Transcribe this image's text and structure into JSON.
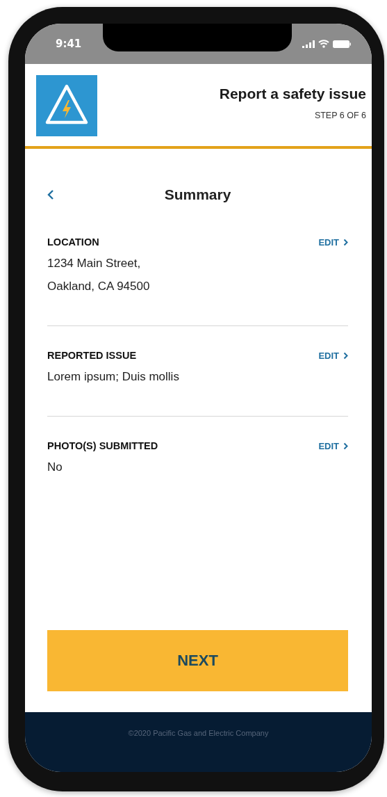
{
  "status_bar": {
    "time": "9:41"
  },
  "header": {
    "title": "Report a safety issue",
    "step": "STEP 6 OF 6"
  },
  "page": {
    "title": "Summary"
  },
  "sections": [
    {
      "label": "LOCATION",
      "edit": "EDIT",
      "lines": [
        "1234 Main Street,",
        "Oakland, CA 94500"
      ]
    },
    {
      "label": "REPORTED ISSUE",
      "edit": "EDIT",
      "lines": [
        "Lorem ipsum; Duis mollis"
      ]
    },
    {
      "label": "PHOTO(S) SUBMITTED",
      "edit": "EDIT",
      "lines": [
        "No"
      ]
    }
  ],
  "next_button": "NEXT",
  "footer": "©2020 Pacific Gas and Electric Company"
}
